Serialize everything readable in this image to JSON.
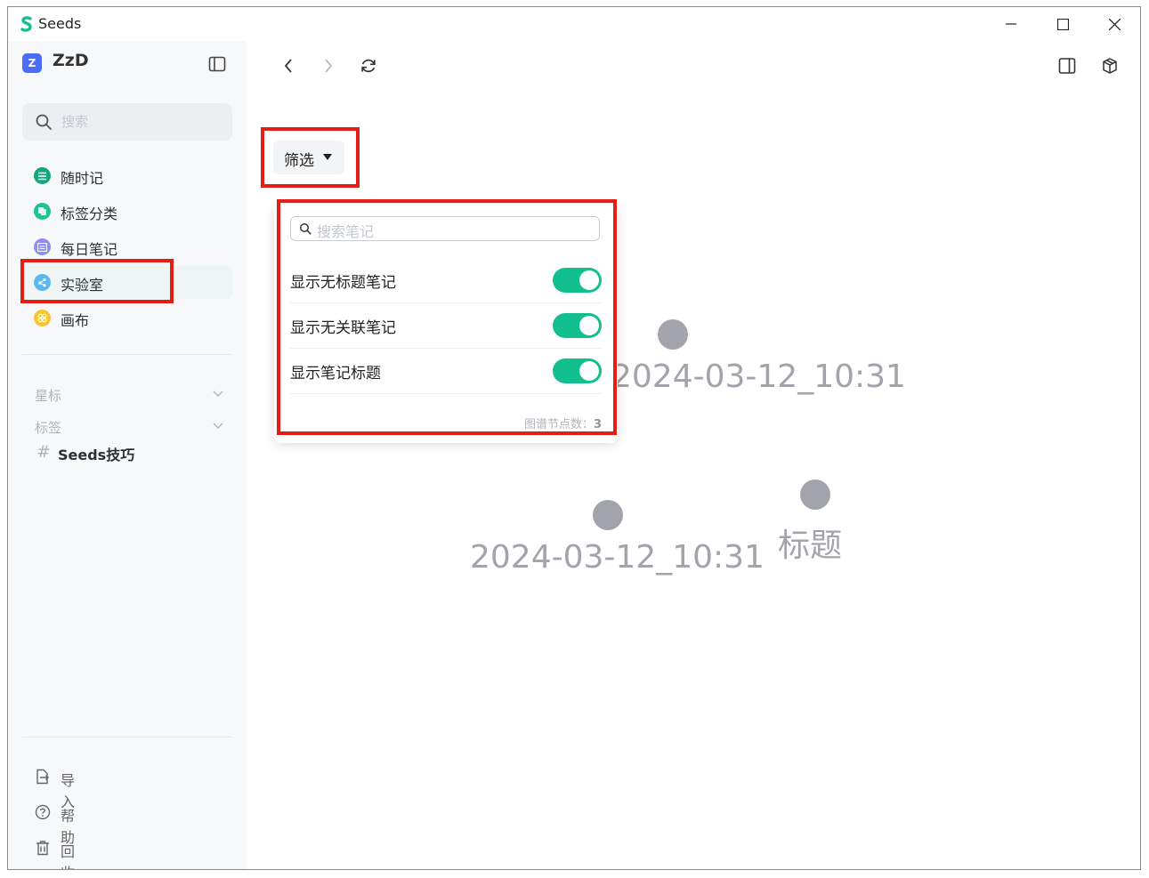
{
  "app": {
    "title": "Seeds"
  },
  "colors": {
    "accent": "#12bf8f",
    "highlight": "#e41d17",
    "node": "#a3a3ab"
  },
  "sidebar": {
    "workspace": {
      "avatar": "Z",
      "name": "ZzD"
    },
    "search": {
      "placeholder": "搜索"
    },
    "nav": [
      {
        "label": "随时记",
        "icon": "notes-icon",
        "color": "#15a67d"
      },
      {
        "label": "标签分类",
        "icon": "tags-icon",
        "color": "#1fc48f"
      },
      {
        "label": "每日笔记",
        "icon": "daily-icon",
        "color": "#8c8ff0"
      },
      {
        "label": "实验室",
        "icon": "lab-icon",
        "color": "#5bb8ee"
      },
      {
        "label": "画布",
        "icon": "canvas-icon",
        "color": "#f6c530"
      }
    ],
    "sections": {
      "starred": "星标",
      "tags": "标签"
    },
    "tag_items": [
      {
        "hash": "#",
        "label": "Seeds技巧"
      }
    ],
    "bottom": [
      {
        "label": "导入",
        "icon": "import-icon"
      },
      {
        "label": "帮助",
        "icon": "help-icon"
      },
      {
        "label": "回收站",
        "icon": "trash-icon"
      }
    ]
  },
  "filter": {
    "button_label": "筛选",
    "search_placeholder": "搜索笔记",
    "options": [
      {
        "label": "显示无标题笔记",
        "enabled": true
      },
      {
        "label": "显示无关联笔记",
        "enabled": true
      },
      {
        "label": "显示笔记标题",
        "enabled": true
      }
    ],
    "node_count_label": "图谱节点数：",
    "node_count_value": "3"
  },
  "graph": {
    "nodes": [
      {
        "label": "2024-03-12_10:31"
      },
      {
        "label": "2024-03-12_10:31"
      },
      {
        "label": "标题"
      }
    ]
  }
}
